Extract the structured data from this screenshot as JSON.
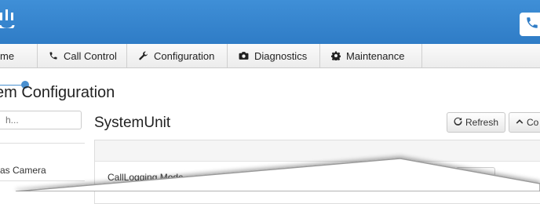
{
  "header": {
    "logo_text": "cisco-logo",
    "phone_icon": "phone-icon",
    "brand_color": "#3a88d2"
  },
  "nav": {
    "tabs": [
      {
        "label": "me",
        "icon": "home-icon"
      },
      {
        "label": "Call Control",
        "icon": "phone-icon"
      },
      {
        "label": "Configuration",
        "icon": "wrench-icon"
      },
      {
        "label": "Diagnostics",
        "icon": "camera-icon"
      },
      {
        "label": "Maintenance",
        "icon": "gear-icon"
      }
    ]
  },
  "page": {
    "title": "em Configuration"
  },
  "sidebar": {
    "search_placeholder": "h...",
    "items": [
      {
        "label": "ras Camera"
      }
    ]
  },
  "main": {
    "section_title": "SystemUnit",
    "refresh_label": "Refresh",
    "collapse_label": "Co",
    "row_label": "CallLogging Mode"
  }
}
